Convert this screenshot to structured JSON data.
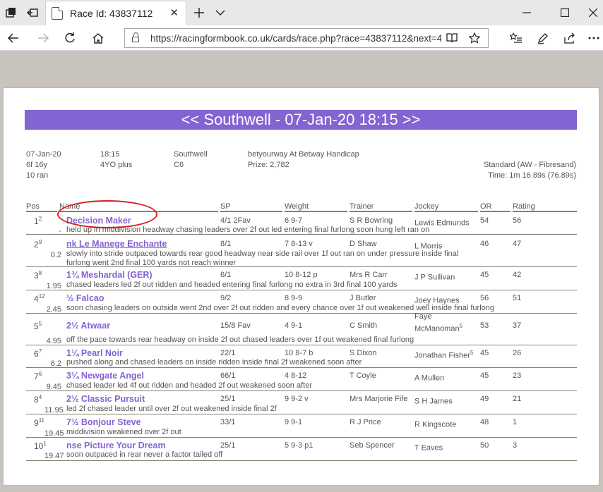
{
  "browser": {
    "tab_title": "Race Id: 43837112",
    "url": "https://racingformbook.co.uk/cards/race.php?race=43837112&next=43"
  },
  "race": {
    "header": "<< Southwell - 07-Jan-20 18:15 >>",
    "date": "07-Jan-20",
    "time": "18:15",
    "course": "Southwell",
    "race_name": "betyourway At Betway Handicap",
    "distance": "6f 16y",
    "age": "4YO plus",
    "class": "C6",
    "prize": "Prize: 2,782",
    "going": "Standard (AW - Fibresand)",
    "runners": "10 ran",
    "win_time": "Time: 1m 16.89s (76.89s)"
  },
  "columns": {
    "pos": "Pos",
    "name": "Name",
    "sp": "SP",
    "weight": "Weight",
    "trainer": "Trainer",
    "jockey": "Jockey",
    "or": "OR",
    "rating": "Rating"
  },
  "runners": [
    {
      "pos": "1",
      "draw": "2",
      "btn": "-",
      "name": "Decision Maker",
      "sp": "4/1 2Fav",
      "weight": "6 9-7",
      "trainer": "S R Bowring",
      "jockey": "Lewis Edmunds",
      "jockey_claim": "",
      "or": "54",
      "rating": "56",
      "comment": "held up in middivision headway chasing leaders over 2f out led entering final furlong soon hung left ran on"
    },
    {
      "pos": "2",
      "draw": "9",
      "btn": "0.2",
      "name": "nk Le Manege Enchante",
      "sp": "8/1",
      "weight": "7 8-13 v",
      "trainer": "D Shaw",
      "jockey": "L Morris",
      "jockey_claim": "",
      "or": "46",
      "rating": "47",
      "comment": "slowly into stride outpaced towards rear good headway near side rail over 1f out ran on under pressure inside final furlong went 2nd final 100 yards not reach winner"
    },
    {
      "pos": "3",
      "draw": "8",
      "btn": "1.95",
      "name": "1¾ Meshardal (GER)",
      "sp": "6/1",
      "weight": "10 8-12 p",
      "trainer": "Mrs R Carr",
      "jockey": "J P Sullivan",
      "jockey_claim": "",
      "or": "45",
      "rating": "42",
      "comment": "chased leaders led 2f out ridden and headed entering final furlong no extra in 3rd final 100 yards"
    },
    {
      "pos": "4",
      "draw": "12",
      "btn": "2.45",
      "name": "½ Falcao",
      "sp": "9/2",
      "weight": "8 9-9",
      "trainer": "J Butler",
      "jockey": "Joey Haynes",
      "jockey_claim": "",
      "or": "56",
      "rating": "51",
      "comment": "soon chasing leaders on outside went 2nd over 2f out ridden and every chance over 1f out weakened well inside final furlong"
    },
    {
      "pos": "5",
      "draw": "5",
      "btn": "4.95",
      "name": "2½ Atwaar",
      "sp": "15/8 Fav",
      "weight": "4 9-1",
      "trainer": "C Smith",
      "jockey": "Faye McManoman",
      "jockey_claim": "5",
      "or": "53",
      "rating": "37",
      "comment": "off the pace towards rear headway on inside 2f out chased leaders over 1f out weakened final furlong"
    },
    {
      "pos": "6",
      "draw": "7",
      "btn": "6.2",
      "name": "1¼ Pearl Noir",
      "sp": "22/1",
      "weight": "10 8-7 b",
      "trainer": "S Dixon",
      "jockey": "Jonathan Fisher",
      "jockey_claim": "5",
      "or": "45",
      "rating": "26",
      "comment": "pushed along and chased leaders on inside ridden inside final 2f weakened soon after"
    },
    {
      "pos": "7",
      "draw": "6",
      "btn": "9.45",
      "name": "3¼ Newgate Angel",
      "sp": "66/1",
      "weight": "4 8-12",
      "trainer": "T Coyle",
      "jockey": "A Mullen",
      "jockey_claim": "",
      "or": "45",
      "rating": "23",
      "comment": "chased leader led 4f out ridden and headed 2f out weakened soon after"
    },
    {
      "pos": "8",
      "draw": "4",
      "btn": "11.95",
      "name": "2½ Classic Pursuit",
      "sp": "25/1",
      "weight": "9 9-2 v",
      "trainer": "Mrs Marjorie Fife",
      "jockey": "S H James",
      "jockey_claim": "",
      "or": "49",
      "rating": "21",
      "comment": "led 2f chased leader until over 2f out weakened inside final 2f"
    },
    {
      "pos": "9",
      "draw": "11",
      "btn": "19.45",
      "name": "7½ Bonjour Steve",
      "sp": "33/1",
      "weight": "9 9-1",
      "trainer": "R J Price",
      "jockey": "R Kingscote",
      "jockey_claim": "",
      "or": "48",
      "rating": "1",
      "comment": "middivision weakened over 2f out"
    },
    {
      "pos": "10",
      "draw": "1",
      "btn": "19.47",
      "name": "nse Picture Your Dream",
      "sp": "25/1",
      "weight": "5 9-3 p1",
      "trainer": "Seb Spencer",
      "jockey": "T Eaves",
      "jockey_claim": "",
      "or": "50",
      "rating": "3",
      "comment": "soon outpaced in rear never a factor tailed off"
    }
  ]
}
